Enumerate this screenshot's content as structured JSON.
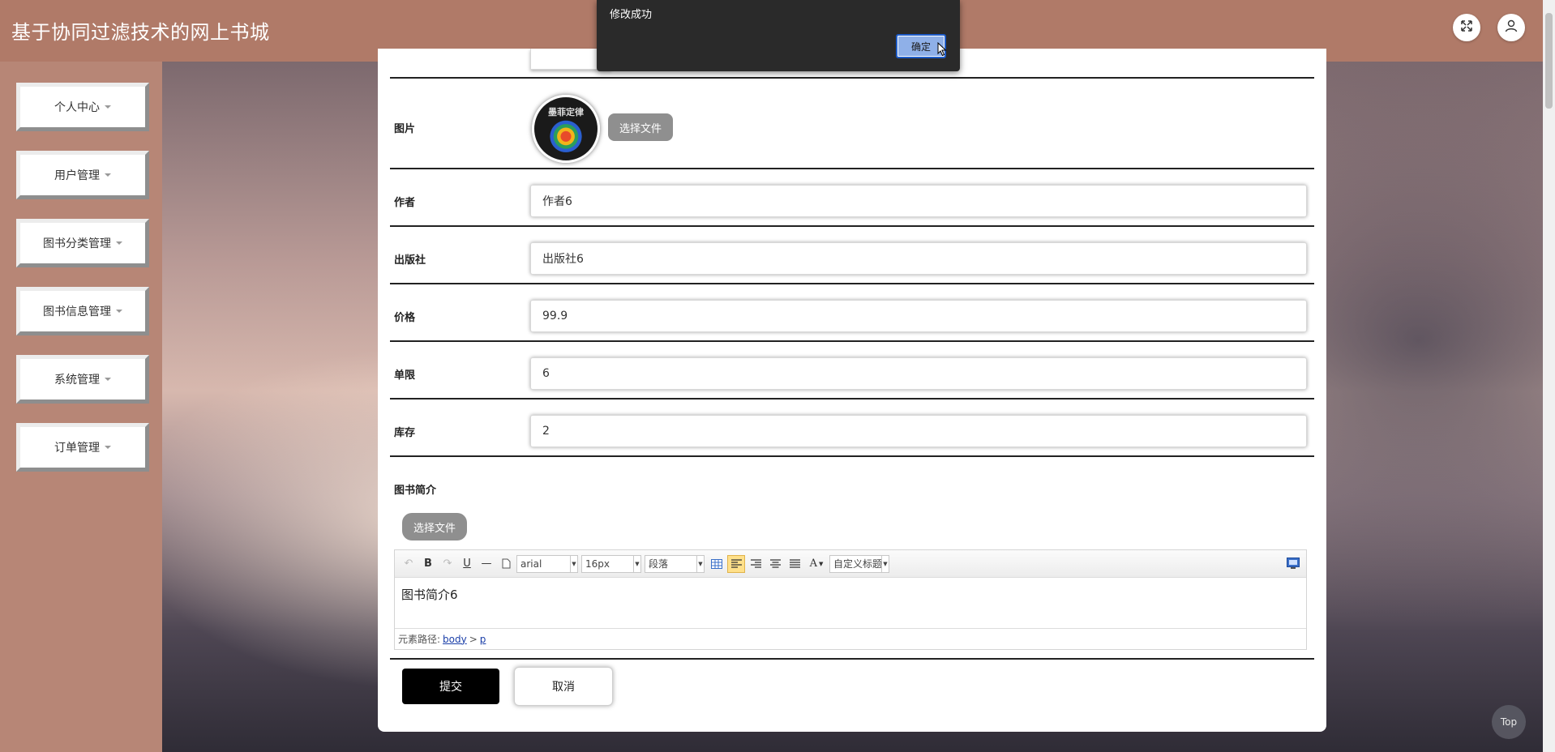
{
  "header": {
    "title": "基于协同过滤技术的网上书城",
    "fullscreen_icon": "expand-icon",
    "user_icon": "user-icon"
  },
  "sidebar": {
    "items": [
      {
        "label": "个人中心"
      },
      {
        "label": "用户管理"
      },
      {
        "label": "图书分类管理"
      },
      {
        "label": "图书信息管理"
      },
      {
        "label": "系统管理"
      },
      {
        "label": "订单管理"
      }
    ]
  },
  "form": {
    "image_label": "图片",
    "choose_file": "选择文件",
    "cover_text": "墨菲定律",
    "author_label": "作者",
    "author_value": "作者6",
    "publisher_label": "出版社",
    "publisher_value": "出版社6",
    "price_label": "价格",
    "price_value": "99.9",
    "limit_label": "单限",
    "limit_value": "6",
    "stock_label": "库存",
    "stock_value": "2",
    "intro_label": "图书简介",
    "intro_choose_file": "选择文件",
    "submit": "提交",
    "cancel": "取消"
  },
  "editor": {
    "font_family": "arial",
    "font_size": "16px",
    "paragraph": "段落",
    "custom_title": "自定义标题",
    "content": "图书简介6",
    "path_label": "元素路径:",
    "path_body": "body",
    "path_sep": ">",
    "path_p": "p"
  },
  "dialog": {
    "message": "修改成功",
    "ok": "确定"
  },
  "top_button": "Top",
  "colors": {
    "header": "#b07a68",
    "sidebar": "#b78676",
    "dialog": "#2a2a2a",
    "submit": "#000000"
  }
}
